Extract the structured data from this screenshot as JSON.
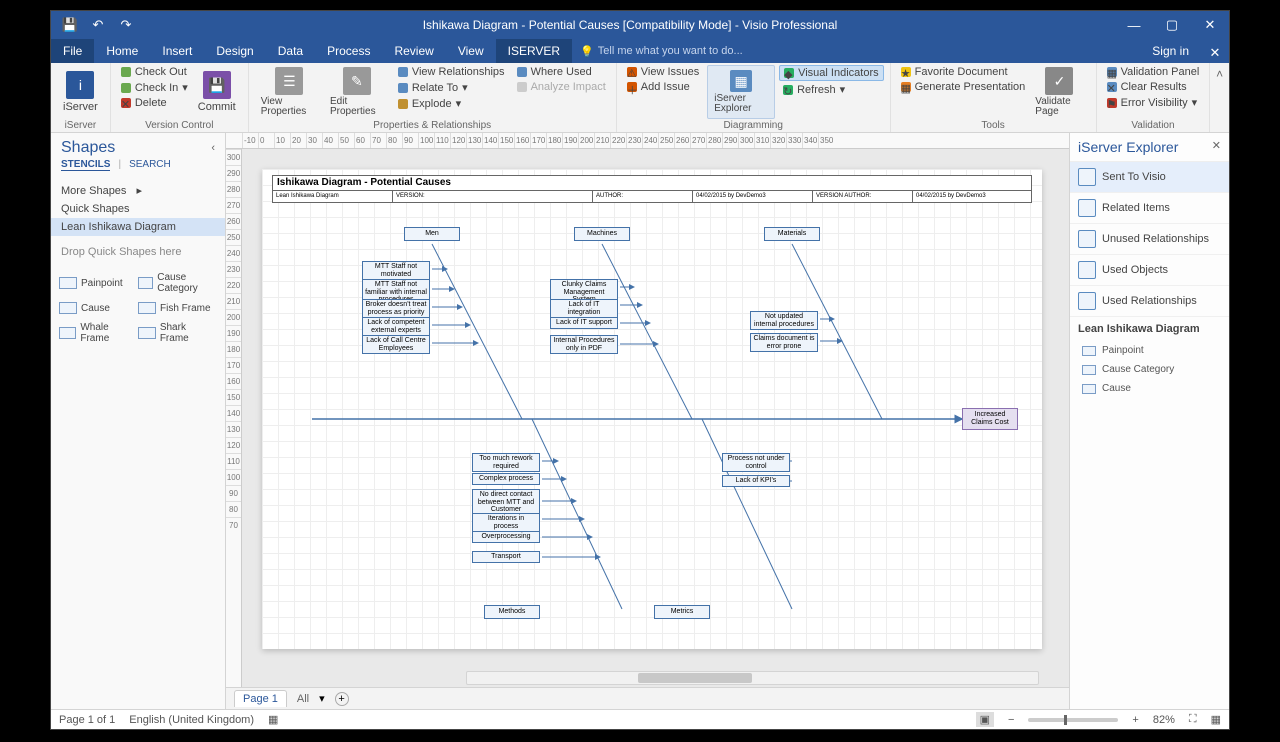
{
  "titlebar": {
    "title": "Ishikawa Diagram - Potential Causes  [Compatibility Mode] - Visio Professional"
  },
  "menubar": {
    "tabs": [
      "File",
      "Home",
      "Insert",
      "Design",
      "Data",
      "Process",
      "Review",
      "View",
      "ISERVER"
    ],
    "active": "ISERVER",
    "tellme": "Tell me what you want to do...",
    "signin": "Sign in"
  },
  "ribbon": {
    "iserver": {
      "big": "iServer",
      "group": "iServer"
    },
    "version": {
      "items": [
        "Check Out",
        "Check In",
        "Delete"
      ],
      "commit": "Commit",
      "group": "Version Control"
    },
    "props": {
      "viewProps": "View Properties",
      "editProps": "Edit Properties",
      "viewRel": "View Relationships",
      "relateTo": "Relate To",
      "explode": "Explode",
      "whereUsed": "Where Used",
      "analyzeImpact": "Analyze Impact",
      "group": "Properties & Relationships"
    },
    "diag": {
      "viewIssues": "View Issues",
      "addIssue": "Add Issue",
      "explorer": "iServer Explorer",
      "visual": "Visual Indicators",
      "refresh": "Refresh",
      "group": "Diagramming"
    },
    "tools": {
      "fav": "Favorite Document",
      "gen": "Generate Presentation",
      "validate": "Validate Page",
      "group": "Tools"
    },
    "valid": {
      "panel": "Validation Panel",
      "clear": "Clear Results",
      "vis": "Error Visibility",
      "group": "Validation"
    }
  },
  "shapesPane": {
    "title": "Shapes",
    "tabs": {
      "stencils": "STENCILS",
      "search": "SEARCH"
    },
    "more": "More Shapes",
    "quick": "Quick Shapes",
    "lean": "Lean Ishikawa Diagram",
    "drop": "Drop Quick Shapes here",
    "stencils": [
      "Painpoint",
      "Cause Category",
      "Cause",
      "Fish Frame",
      "Whale Frame",
      "Shark Frame"
    ]
  },
  "doc": {
    "title": "Ishikawa Diagram - Potential Causes",
    "meta": {
      "m1": "Lean Ishikawa Diagram",
      "m2label": "VERSION:",
      "m3label": "AUTHOR:",
      "m4": "04/02/2015 by DevDemo3",
      "m5label": "VERSION AUTHOR:",
      "m6": "04/02/2015 by DevDemo3"
    },
    "head": "Increased Claims Cost",
    "cats": {
      "men": "Men",
      "machines": "Machines",
      "materials": "Materials",
      "methods": "Methods",
      "metrics": "Metrics"
    },
    "causes": {
      "men": [
        "MTT Staff not motivated",
        "MTT Staff not familiar with internal procedures",
        "Broker doesn't treat process as priority",
        "Lack of competent external experts",
        "Lack of Call Centre Employees"
      ],
      "machines": [
        "Clunky Claims Management System",
        "Lack of IT integration",
        "Lack of IT support",
        "Internal Procedures only in PDF"
      ],
      "materials": [
        "Not updated internal procedures",
        "Claims document is error prone"
      ],
      "methods": [
        "Too much rework required",
        "Complex process",
        "No direct contact between MTT and Customer",
        "Iterations in process",
        "Overprocessing",
        "Transport"
      ],
      "metrics": [
        "Process not under control",
        "Lack of KPI's"
      ]
    }
  },
  "pageTabs": {
    "page1": "Page 1",
    "all": "All"
  },
  "explorer": {
    "title": "iServer Explorer",
    "items": [
      "Sent To Visio",
      "Related Items",
      "Unused Relationships",
      "Used Objects",
      "Used Relationships"
    ],
    "subtitle": "Lean Ishikawa Diagram",
    "shapes": [
      "Painpoint",
      "Cause Category",
      "Cause"
    ]
  },
  "status": {
    "page": "Page 1 of 1",
    "lang": "English (United Kingdom)",
    "zoom": "82%"
  },
  "ruler_h": [
    "-10",
    "0",
    "10",
    "20",
    "30",
    "40",
    "50",
    "60",
    "70",
    "80",
    "90",
    "100",
    "110",
    "120",
    "130",
    "140",
    "150",
    "160",
    "170",
    "180",
    "190",
    "200",
    "210",
    "220",
    "230",
    "240",
    "250",
    "260",
    "270",
    "280",
    "290",
    "300",
    "310",
    "320",
    "330",
    "340",
    "350"
  ],
  "ruler_v": [
    "300",
    "290",
    "280",
    "270",
    "260",
    "250",
    "240",
    "230",
    "220",
    "210",
    "200",
    "190",
    "180",
    "170",
    "160",
    "150",
    "140",
    "130",
    "120",
    "110",
    "100",
    "90",
    "80",
    "70"
  ]
}
